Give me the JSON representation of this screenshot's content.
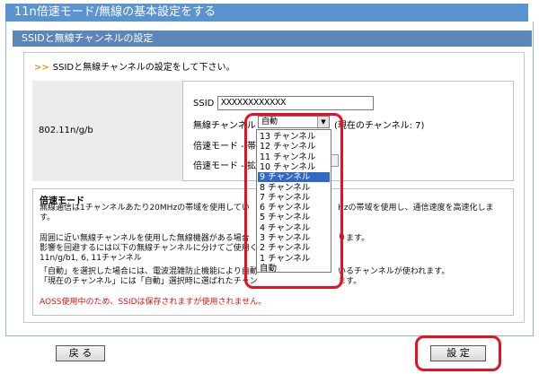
{
  "header": {
    "title": "11n倍速モード/無線の基本設定をする",
    "section": "SSIDと無線チャンネルの設定"
  },
  "instruction": "SSIDと無線チャンネルの設定をして下さい。",
  "mode": {
    "label": "802.11n/g/b"
  },
  "form": {
    "ssid_label": "SSID :",
    "ssid_value": "XXXXXXXXXXXX",
    "channel_label": "無線チャンネル :",
    "channel_selected": "自動",
    "current_channel": "(現在のチャンネル: 7)",
    "double_speed_label": "倍速モード - 帯域 :",
    "ext_channel_label": "倍速モード - 拡張チャンネル :"
  },
  "channel_options": [
    "13 チャンネル",
    "12 チャンネル",
    "11 チャンネル",
    "10 チャンネル",
    "9 チャンネル",
    "8 チャンネル",
    "7 チャンネル",
    "6 チャンネル",
    "5 チャンネル",
    "4 チャンネル",
    "3 チャンネル",
    "2 チャンネル",
    "1 チャンネル",
    "自動"
  ],
  "channel_highlighted": "9 チャンネル",
  "help": {
    "title": "倍速モード",
    "line1": "無線通信は1チャンネルあたり20MHzの帯域を使用してい",
    "line1_tail": "Hzの帯域を使用し、通信速度を高速化しま",
    "line2": "す。",
    "line3": "周囲に近い無線チャンネルを使用した無線機器がある場合",
    "line3_tail": "ります。",
    "line4": "影響を回避するには以下の無線チャンネルに分けてご使用く",
    "line5": "11n/g/b1, 6, 11チャンネル",
    "line6": "「自動」を選択した場合には、電波混雑防止機能により自動",
    "line6_tail": "いるチャンネルが使われます。",
    "line7": "「現在のチャンネル」には「自動」選択時に選ばれたチャン",
    "line7_tail": "ます。",
    "aoss_note": "AOSS使用中のため、SSIDは保存されますが使用されません。"
  },
  "buttons": {
    "back": "戻 る",
    "settings": "設 定"
  },
  "colors": {
    "title_bar": "#5b93d1",
    "section_bar": "#5c86b8",
    "highlight": "#e6101e",
    "selected_item": "#3168c6",
    "aoss_note": "#e01010"
  }
}
